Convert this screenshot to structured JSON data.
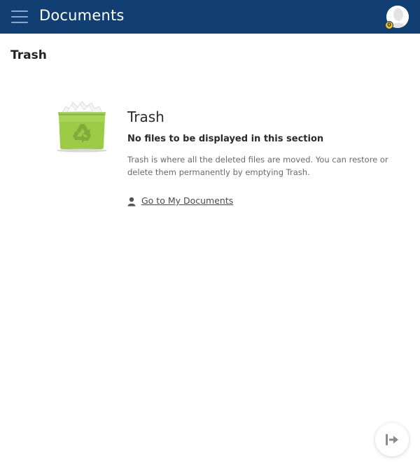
{
  "header": {
    "title": "Documents",
    "menu_icon": "hamburger-menu-icon",
    "avatar_icon": "user-avatar-icon",
    "notification_count": "0",
    "colors": {
      "bar": "#123f73",
      "badge": "#f1c40f"
    }
  },
  "page": {
    "title": "Trash"
  },
  "empty_state": {
    "illustration_icon": "recycle-bin-icon",
    "title": "Trash",
    "subtitle": "No files to be displayed in this section",
    "description": "Trash is where all the deleted files are moved. You can restore or delete them permanently by emptying Trash.",
    "link_icon": "user-icon",
    "link_label": "Go to My Documents"
  },
  "fab": {
    "icon": "logout-arrow-icon"
  }
}
